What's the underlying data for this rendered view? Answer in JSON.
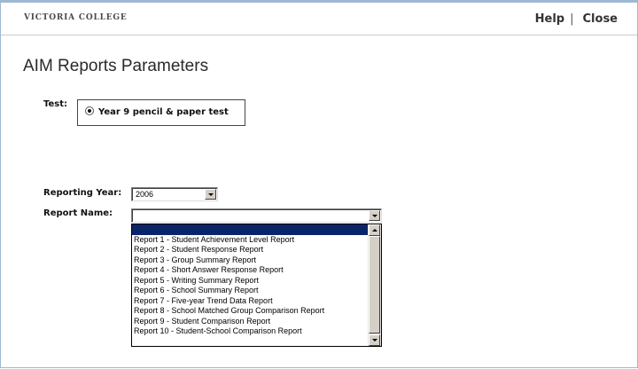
{
  "header": {
    "brand": "VICTORIA COLLEGE",
    "help_label": "Help",
    "separator": "|",
    "close_label": "Close"
  },
  "page": {
    "title": "AIM Reports Parameters"
  },
  "test": {
    "label": "Test:",
    "option_label": "Year 9 pencil & paper test",
    "selected": true
  },
  "reporting_year": {
    "label": "Reporting Year:",
    "value": "2006"
  },
  "report_name": {
    "label": "Report Name:",
    "value": "",
    "options": [
      "",
      "Report 1 - Student Achievement Level Report",
      "Report 2 - Student Response Report",
      "Report 3 - Group Summary Report",
      "Report 4 - Short Answer Response Report",
      "Report 5 - Writing Summary Report",
      "Report 6 - School Summary Report",
      "Report 7 - Five-year Trend Data Report",
      "Report 8 - School Matched Group Comparison Report",
      "Report 9 - Student Comparison Report",
      "Report 10 - Student-School Comparison Report"
    ],
    "highlighted_index": 0
  },
  "icons": {
    "dropdown": "chevron-down-icon",
    "scroll_up": "arrow-up-icon",
    "scroll_down": "arrow-down-icon",
    "radio": "radio-selected-icon"
  },
  "colors": {
    "frame_border": "#9fb8d2",
    "selection": "#0a246a"
  }
}
